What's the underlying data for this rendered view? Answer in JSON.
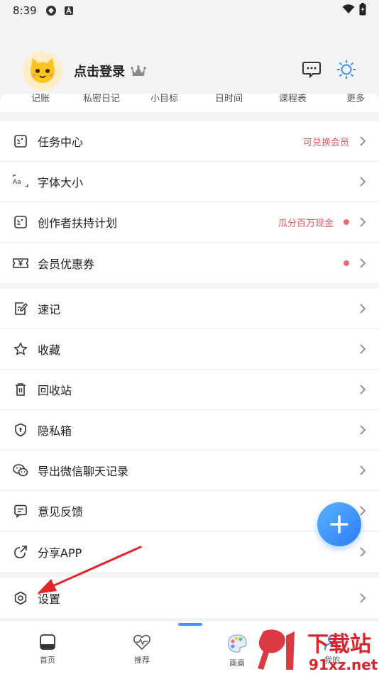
{
  "status_bar": {
    "time": "8:39"
  },
  "profile": {
    "login_text": "点击登录"
  },
  "quick_strip": [
    "记账",
    "私密日记",
    "小目标",
    "日时间",
    "课程表",
    "更多"
  ],
  "group1": [
    {
      "label": "任务中心",
      "note": "可兑换会员",
      "dot": false
    },
    {
      "label": "字体大小",
      "note": "",
      "dot": false
    },
    {
      "label": "创作者扶持计划",
      "note": "瓜分百万现金",
      "dot": true
    },
    {
      "label": "会员优惠券",
      "note": "",
      "dot": true
    }
  ],
  "group2": [
    {
      "label": "速记"
    },
    {
      "label": "收藏"
    },
    {
      "label": "回收站"
    },
    {
      "label": "隐私箱"
    },
    {
      "label": "导出微信聊天记录"
    },
    {
      "label": "意见反馈"
    },
    {
      "label": "分享APP"
    }
  ],
  "group3": [
    {
      "label": "设置"
    }
  ],
  "bottom_nav": [
    {
      "label": "首页"
    },
    {
      "label": "推荐"
    },
    {
      "label": "画画"
    },
    {
      "label": "我的"
    }
  ],
  "watermark": {
    "main": "下载站",
    "sub": "91xz.net"
  },
  "colors": {
    "accent": "#2e7cf6",
    "note": "#e55561",
    "dot": "#ec6a78",
    "annotation_arrow": "#e0262b"
  }
}
